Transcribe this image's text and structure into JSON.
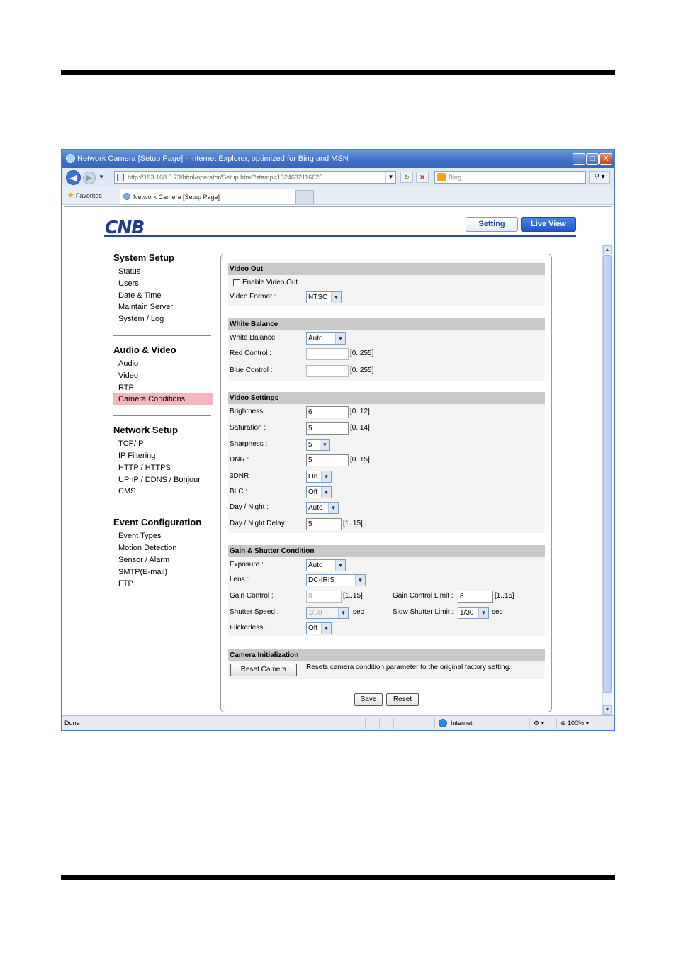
{
  "window": {
    "title": "Network Camera [Setup Page] - Internet Explorer, optimized for Bing and MSN",
    "minimize": "_",
    "maximize": "□",
    "close": "X"
  },
  "nav": {
    "back": "◀",
    "forward": "▶",
    "url": "http://193.168.0.73/html/operator/Setup.html?stamp=1324632116625",
    "search_placeholder": "Bing"
  },
  "tabs": {
    "favorites": "Favorites",
    "active_tab": "Network Camera [Setup Page]"
  },
  "header": {
    "logo": "CNB",
    "setting": "Setting",
    "live_view": "Live View"
  },
  "sidebar": [
    {
      "title": "System Setup",
      "items": [
        "Status",
        "Users",
        "Date & Time",
        "Maintain Server",
        "System / Log"
      ]
    },
    {
      "title": "Audio & Video",
      "items": [
        "Audio",
        "Video",
        "RTP",
        "Camera Conditions"
      ]
    },
    {
      "title": "Network Setup",
      "items": [
        "TCP/IP",
        "IP Filtering",
        "HTTP / HTTPS",
        "UPnP / DDNS / Bonjour",
        "CMS"
      ]
    },
    {
      "title": "Event Configuration",
      "items": [
        "Event Types",
        "Motion Detection",
        "Sensor / Alarm",
        "SMTP(E-mail)",
        "FTP"
      ]
    }
  ],
  "video_out": {
    "title": "Video Out",
    "enable_label": "Enable Video Out",
    "format_label": "Video Format :",
    "format_value": "NTSC"
  },
  "white_balance": {
    "title": "White Balance",
    "wb_label": "White Balance :",
    "wb_value": "Auto",
    "red_label": "Red Control :",
    "red_value": "-",
    "red_range": "[0..255]",
    "blue_label": "Blue Control :",
    "blue_value": "-",
    "blue_range": "[0..255]"
  },
  "video_settings": {
    "title": "Video Settings",
    "brightness_label": "Brightness :",
    "brightness_value": "6",
    "brightness_range": "[0..12]",
    "saturation_label": "Saturation :",
    "saturation_value": "5",
    "saturation_range": "[0..14]",
    "sharpness_label": "Sharpness :",
    "sharpness_value": "5",
    "dnr_label": "DNR :",
    "dnr_value": "5",
    "dnr_range": "[0..15]",
    "dnr3_label": "3DNR :",
    "dnr3_value": "On",
    "blc_label": "BLC :",
    "blc_value": "Off",
    "daynight_label": "Day / Night :",
    "daynight_value": "Auto",
    "delay_label": "Day / Night Delay :",
    "delay_value": "5",
    "delay_range": "[1..15]"
  },
  "gain_shutter": {
    "title": "Gain & Shutter Condition",
    "exposure_label": "Exposure :",
    "exposure_value": "Auto",
    "lens_label": "Lens :",
    "lens_value": "DC-IRIS",
    "gain_label": "Gain Control :",
    "gain_value": "8",
    "gain_range": "[1..15]",
    "gain_limit_label": "Gain Control Limit :",
    "gain_limit_value": "8",
    "gain_limit_range": "[1..15]",
    "shutter_label": "Shutter Speed :",
    "shutter_value": "1/30",
    "shutter_unit": "sec",
    "slow_label": "Slow Shutter Limit :",
    "slow_value": "1/30",
    "slow_unit": "sec",
    "flicker_label": "Flickerless :",
    "flicker_value": "Off"
  },
  "camera_init": {
    "title": "Camera Initialization",
    "reset_button": "Reset Camera",
    "description": "Resets camera condition parameter to the original factory setting."
  },
  "actions": {
    "save": "Save",
    "reset": "Reset"
  },
  "status": {
    "text": "Done",
    "zone": "Internet",
    "zoom": "100%"
  }
}
